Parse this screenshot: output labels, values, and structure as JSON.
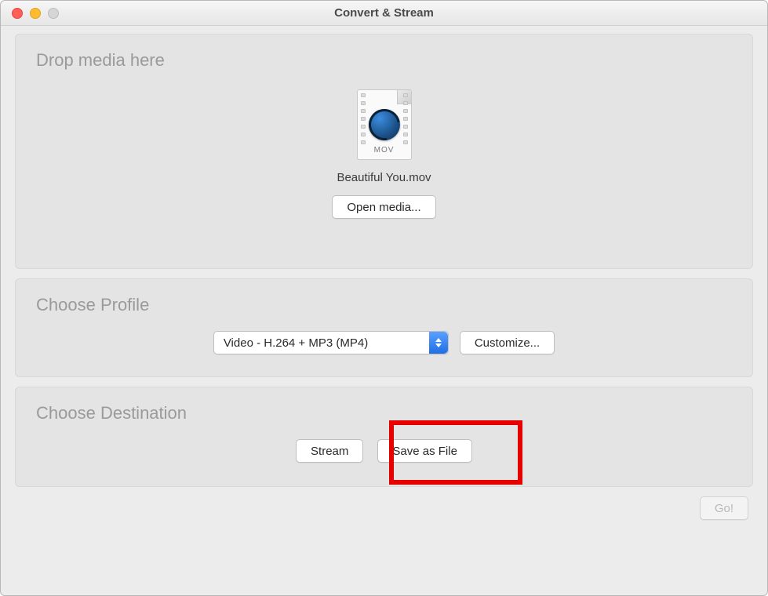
{
  "window": {
    "title": "Convert & Stream"
  },
  "drop": {
    "section_title": "Drop media here",
    "file_ext": "MOV",
    "filename": "Beautiful You.mov",
    "open_button": "Open media..."
  },
  "profile": {
    "section_title": "Choose Profile",
    "selected": "Video - H.264 + MP3 (MP4)",
    "customize_button": "Customize..."
  },
  "destination": {
    "section_title": "Choose Destination",
    "stream_button": "Stream",
    "save_button": "Save as File"
  },
  "footer": {
    "go_button": "Go!"
  }
}
